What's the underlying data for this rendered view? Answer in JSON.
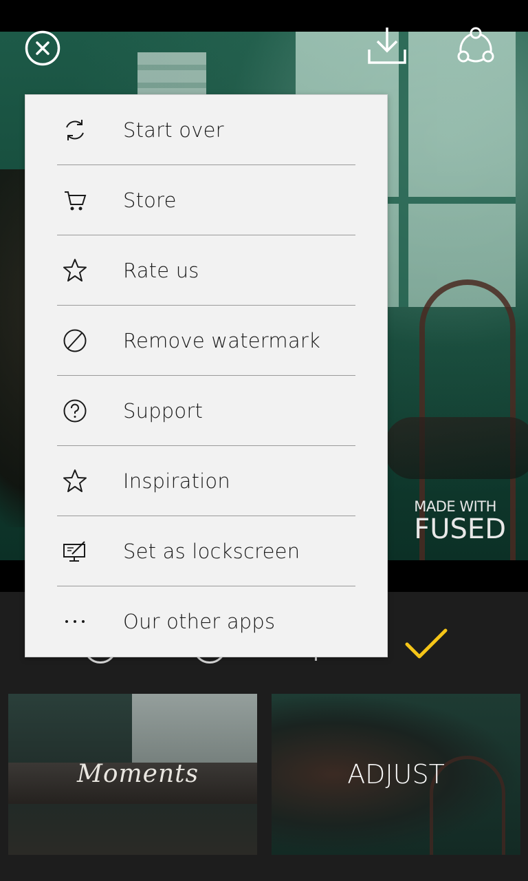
{
  "top_bar": {
    "close_icon": "close-circle-icon",
    "download_icon": "download-icon",
    "share_icon": "share-icon"
  },
  "photo": {
    "watermark_line1": "MADE WITH",
    "watermark_line2": "FUSED"
  },
  "menu": {
    "items": [
      {
        "label": "Start over",
        "icon": "refresh-icon"
      },
      {
        "label": "Store",
        "icon": "cart-icon"
      },
      {
        "label": "Rate us",
        "icon": "star-icon"
      },
      {
        "label": "Remove watermark",
        "icon": "prohibited-icon"
      },
      {
        "label": "Support",
        "icon": "help-icon"
      },
      {
        "label": "Inspiration",
        "icon": "star-icon"
      },
      {
        "label": "Set as lockscreen",
        "icon": "lockscreen-icon"
      },
      {
        "label": "Our other apps",
        "icon": "more-icon"
      }
    ]
  },
  "bottom": {
    "confirm_icon": "checkmark-icon",
    "accent_color": "#f5c518",
    "thumbnails": [
      {
        "label": "Moments"
      },
      {
        "label": "ADJUST"
      }
    ]
  }
}
